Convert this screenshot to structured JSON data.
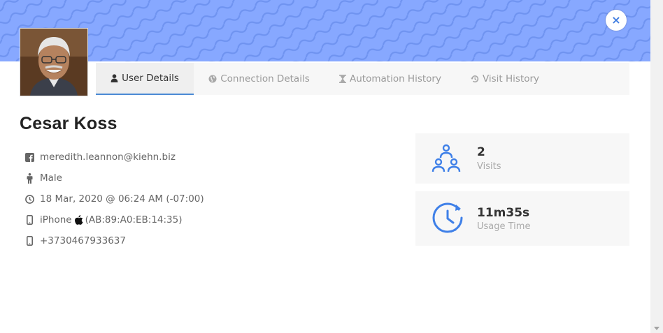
{
  "colors": {
    "banner": "#87a8ff",
    "accent": "#3f80e8",
    "tab_underline": "#4a8ad4"
  },
  "close_button": {
    "icon": "close-icon",
    "glyph": "×"
  },
  "tabs": [
    {
      "label": "User Details",
      "icon": "user-icon",
      "active": true
    },
    {
      "label": "Connection Details",
      "icon": "globe-icon",
      "active": false
    },
    {
      "label": "Automation History",
      "icon": "hourglass-icon",
      "active": false
    },
    {
      "label": "Visit History",
      "icon": "history-icon",
      "active": false
    }
  ],
  "user": {
    "name": "Cesar Koss",
    "email": "meredith.leannon@kiehn.biz",
    "gender": "Male",
    "last_seen": "18 Mar, 2020 @ 06:24 AM (-07:00)",
    "device_name": "iPhone",
    "device_mac": "(AB:89:A0:EB:14:35)",
    "phone": "+3730467933637"
  },
  "stats": {
    "visits": {
      "value": "2",
      "label": "Visits"
    },
    "usage": {
      "value": "11m35s",
      "label": "Usage Time"
    }
  }
}
